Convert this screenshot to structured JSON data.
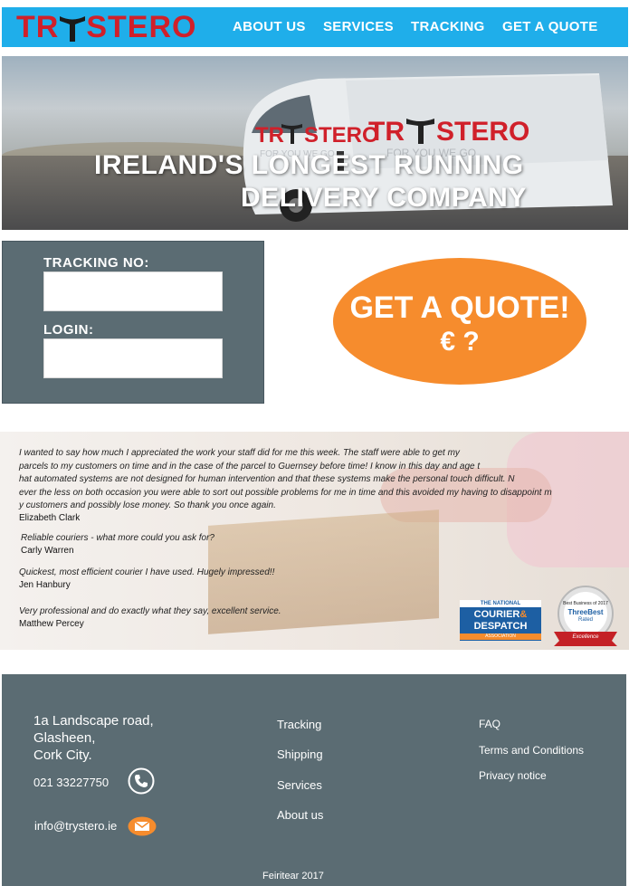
{
  "header": {
    "logo": {
      "left": "TR",
      "right": "STERO"
    },
    "nav": [
      "ABOUT US",
      "SERVICES",
      "TRACKING",
      "GET A QUOTE"
    ]
  },
  "hero": {
    "van_logo": {
      "left": "TR",
      "right": "STERO",
      "tagline": "FOR YOU WE GO"
    },
    "title_line1": "IRELAND'S LONGEST RUNNING",
    "title_line2": "DELIVERY COMPANY"
  },
  "tracking": {
    "tracking_label": "TRACKING NO:",
    "tracking_value": "",
    "login_label": "LOGIN:",
    "login_value": ""
  },
  "quote": {
    "line1": "GET A QUOTE!",
    "line2": "€ ?"
  },
  "testimonials": [
    {
      "lines": [
        "I wanted to say how much I appreciated the work your staff did for me this week. The staff were able to get my",
        "parcels to my customers on time and in the case of the parcel to Guernsey before time! I know in this day and age t",
        "hat automated systems are not designed for human intervention and that these systems make the personal touch difficult. N",
        "ever the less on both occasion you were able to sort out possible problems for me in time and this avoided my having to disappoint m",
        "y customers and possibly lose money. So thank you once again."
      ],
      "author": "Elizabeth Clark"
    },
    {
      "lines": [
        "Reliable couriers - what more could you ask for?"
      ],
      "author": "Carly Warren"
    },
    {
      "lines": [
        "Quickest, most efficient courier I have used. Hugely impressed!!"
      ],
      "author": "Jen Hanbury"
    },
    {
      "lines": [
        "Very professional and do exactly what they say, excellent service."
      ],
      "author": "Matthew Percey"
    }
  ],
  "badges": {
    "ncda": {
      "top": "THE NATIONAL",
      "l1": "COURIER",
      "amp": "&",
      "l2": "DESPATCH",
      "bottom": "ASSOCIATION"
    },
    "threebest": {
      "top": "Best Business of 2017",
      "name": "ThreeBest",
      "sub": "Rated",
      "ribbon": "Excellence"
    }
  },
  "footer": {
    "address": [
      "1a Landscape road,",
      "Glasheen,",
      "Cork City."
    ],
    "phone": "021 33227750",
    "email": "info@trystero.ie",
    "links_col1": [
      "Tracking",
      "Shipping",
      "Services",
      "About us"
    ],
    "links_col2": [
      "FAQ",
      "Terms and Conditions",
      "Privacy notice"
    ],
    "copyright": "Feiritear  2017"
  },
  "colors": {
    "header_blue": "#1faeea",
    "brand_red": "#d0202a",
    "panel_slate": "#5b6c73",
    "quote_orange": "#f68c2d"
  },
  "icons": [
    "phone-icon",
    "envelope-icon",
    "logo-t-icon"
  ]
}
